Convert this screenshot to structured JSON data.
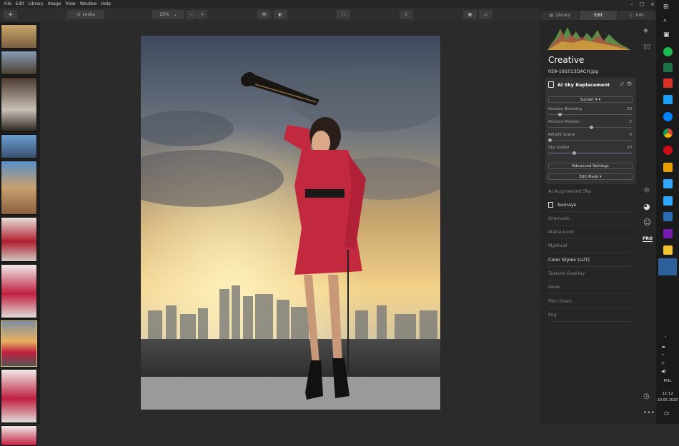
{
  "menu": [
    "File",
    "Edit",
    "Library",
    "Image",
    "View",
    "Window",
    "Help"
  ],
  "window_controls": {
    "minimize": "–",
    "maximize": "□",
    "close": "×"
  },
  "toolbar": {
    "add_label": "+",
    "looks_label": "Looks",
    "zoom_value": "25%",
    "zoom_minus": "–",
    "zoom_plus": "+"
  },
  "tabs": [
    "Library",
    "Edit",
    "Info"
  ],
  "panel": {
    "title": "Creative",
    "filename": "059-191013DACH.jpg",
    "sky_card": {
      "title": "AI Sky Replacement",
      "sky_select": "Sunset 4 ▾",
      "sliders": [
        {
          "label": "Horizon Blending",
          "value": "20",
          "level": 0.12
        },
        {
          "label": "Horizon Position",
          "value": "2",
          "level": 0.51
        },
        {
          "label": "Relight Scene",
          "value": "0",
          "level": 0.0
        },
        {
          "label": "Sky Global",
          "value": "30",
          "level": 0.3
        }
      ],
      "advanced_label": "Advanced Settings",
      "edit_mask_label": "Edit Mask ▾"
    },
    "filters": [
      {
        "label": "AI Augmented Sky",
        "active": false
      },
      {
        "label": "Sunrays",
        "active": true
      },
      {
        "label": "Dramatic",
        "active": false
      },
      {
        "label": "Matte Look",
        "active": false
      },
      {
        "label": "Mystical",
        "active": false
      },
      {
        "label": "Color Styles (LUT)",
        "active": true
      },
      {
        "label": "Texture Overlay",
        "active": false
      },
      {
        "label": "Glow",
        "active": false
      },
      {
        "label": "Film Grain",
        "active": false
      },
      {
        "label": "Fog",
        "active": false
      }
    ],
    "pro_badge": "PRO"
  },
  "taskbar": {
    "lang": "POL",
    "time": "22:12",
    "date": "20.05.2020"
  },
  "colors": {
    "accent": "#d9c27a",
    "panel": "#262626",
    "card": "#333333"
  }
}
